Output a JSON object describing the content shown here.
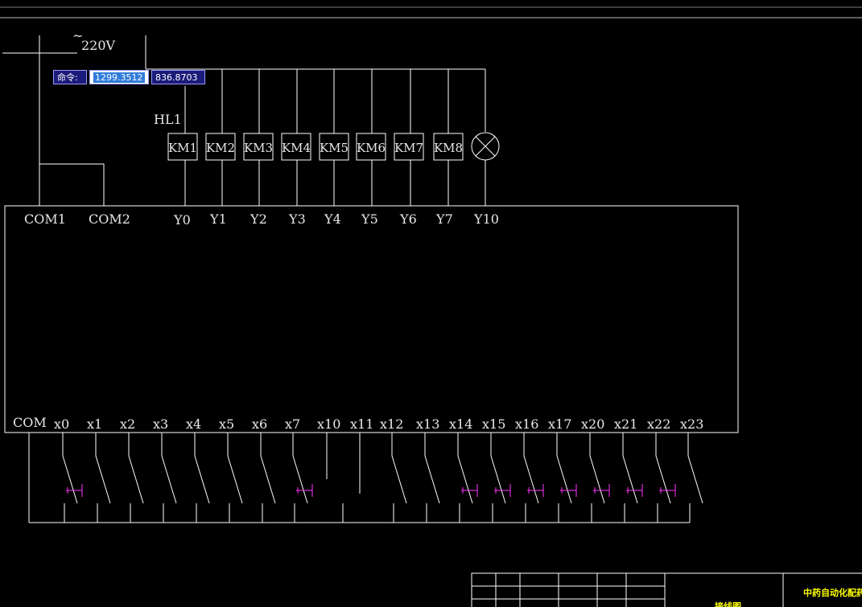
{
  "supply": {
    "voltage_label": "220V",
    "tilde": "~"
  },
  "command_tooltip": {
    "label": "命令:",
    "x_value": "1299.3512",
    "y_value": "836.8703"
  },
  "lamp_label": "HL1",
  "coils": [
    "KM1",
    "KM2",
    "KM3",
    "KM4",
    "KM5",
    "KM6",
    "KM7",
    "KM8"
  ],
  "top_terminals": {
    "com": [
      "COM1",
      "COM2"
    ],
    "outputs": [
      "Y0",
      "Y1",
      "Y2",
      "Y3",
      "Y4",
      "Y5",
      "Y6",
      "Y7",
      "Y10"
    ]
  },
  "bottom_terminals": {
    "com": "COM",
    "inputs": [
      "x0",
      "x1",
      "x2",
      "x3",
      "x4",
      "x5",
      "x6",
      "x7",
      "x10",
      "x11",
      "x12",
      "x13",
      "x14",
      "x15",
      "x16",
      "x17",
      "x20",
      "x21",
      "x22",
      "x23"
    ]
  },
  "title_block": {
    "title_partial": "中药自动化配药设备",
    "subtitle_partial": "接线图"
  },
  "colors": {
    "wire": "#ffffff",
    "pushbutton": "#ff33ff",
    "title_text": "#ffff00"
  }
}
